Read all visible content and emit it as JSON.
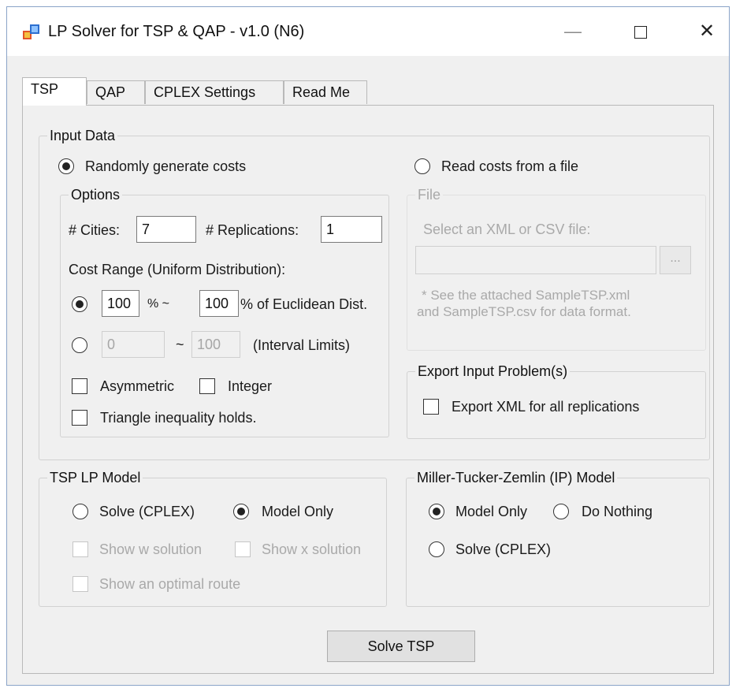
{
  "window": {
    "title": "LP Solver for TSP & QAP - v1.0 (N6)",
    "minimize_glyph": "—",
    "close_glyph": "✕",
    "accent_color": "#8aa4c8"
  },
  "tabs": [
    {
      "label": "TSP",
      "active": true
    },
    {
      "label": "QAP",
      "active": false
    },
    {
      "label": "CPLEX Settings",
      "active": false
    },
    {
      "label": "Read Me",
      "active": false
    }
  ],
  "input_data": {
    "legend": "Input Data",
    "random_label": "Randomly generate costs",
    "random_selected": true,
    "file_label": "Read costs from a file",
    "file_selected": false,
    "options": {
      "legend": "Options",
      "cities_label": "# Cities:",
      "cities_value": "7",
      "replications_label": "# Replications:",
      "replications_value": "1",
      "cost_range_label": "Cost Range (Uniform Distribution):",
      "pct_low": "100",
      "pct_sep": "% ~",
      "pct_high": "100",
      "pct_suffix": "% of Euclidean Dist.",
      "interval_low": "0",
      "interval_sep": "~",
      "interval_high": "100",
      "interval_suffix": "(Interval Limits)",
      "asymmetric_label": "Asymmetric",
      "integer_label": "Integer",
      "triangle_label": "Triangle inequality holds."
    },
    "file": {
      "legend": "File",
      "prompt": "Select an XML or CSV file:",
      "path_value": "",
      "browse_label": "...",
      "note_line1": "* See the attached SampleTSP.xml",
      "note_line2": "and SampleTSP.csv for data format."
    },
    "export": {
      "legend": "Export Input Problem(s)",
      "checkbox_label": "Export XML for all replications"
    }
  },
  "tsp_lp_model": {
    "legend": "TSP LP Model",
    "solve_label": "Solve (CPLEX)",
    "model_only_label": "Model Only",
    "show_w_label": "Show w solution",
    "show_x_label": "Show x solution",
    "show_route_label": "Show an optimal route"
  },
  "mtz_model": {
    "legend": "Miller-Tucker-Zemlin (IP) Model",
    "model_only_label": "Model Only",
    "do_nothing_label": "Do Nothing",
    "solve_label": "Solve (CPLEX)"
  },
  "solve_button": "Solve TSP"
}
